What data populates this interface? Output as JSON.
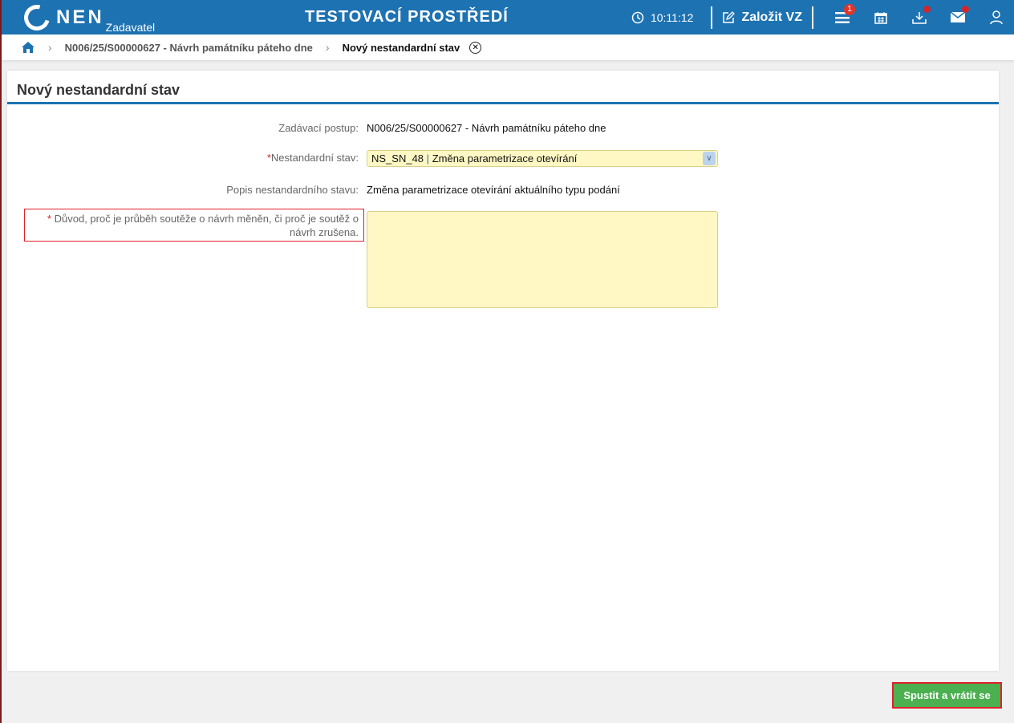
{
  "header": {
    "logo": "NEN",
    "logo_sub": "Zadavatel",
    "environment": "TESTOVACÍ PROSTŘEDÍ",
    "time": "10:11:12",
    "create_label": "Založit VZ",
    "menu_badge": "1"
  },
  "breadcrumb": {
    "parent": "N006/25/S00000627 - Návrh památníku páteho dne",
    "current": "Nový nestandardní stav"
  },
  "page": {
    "title": "Nový nestandardní stav"
  },
  "form": {
    "procedure_label": "Zadávací postup:",
    "procedure_value": "N006/25/S00000627 - Návrh památníku páteho dne",
    "state_label": "Nestandardní stav:",
    "state_code": "NS_SN_48",
    "state_sep": "|",
    "state_name": "Změna parametrizace otevírání",
    "desc_label": "Popis nestandardního stavu:",
    "desc_value": "Změna parametrizace otevírání aktuálního typu podání",
    "reason_label": "Důvod, proč je průběh soutěže o návrh měněn, či proč je soutěž o návrh zrušena.",
    "reason_value": "",
    "required_mark": "*"
  },
  "actions": {
    "submit": "Spustit a vrátit se"
  }
}
